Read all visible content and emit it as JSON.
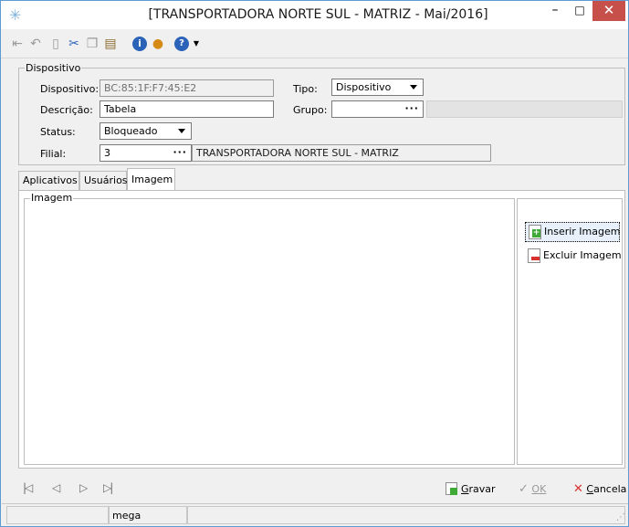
{
  "window": {
    "title": "[TRANSPORTADORA NORTE SUL -  MATRIZ - Mai/2016]",
    "accent": "#5f9bd3",
    "close_color": "#c7504a"
  },
  "toolbar": {
    "icons": [
      "first-icon",
      "back-icon",
      "new-icon",
      "cut-icon",
      "copy-icon",
      "paste-icon",
      "info-icon",
      "user-icon",
      "help-icon"
    ]
  },
  "dispositivo": {
    "legend": "Dispositivo",
    "dispositivo_label": "Dispositivo:",
    "dispositivo_value": "BC:85:1F:F7:45:E2",
    "tipo_label": "Tipo:",
    "tipo_value": "Dispositivo",
    "descricao_label": "Descrição:",
    "descricao_value": "Tabela",
    "grupo_label": "Grupo:",
    "grupo_value": "",
    "status_label": "Status:",
    "status_value": "Bloqueado",
    "filial_label": "Filial:",
    "filial_value": "3",
    "filial_name": "TRANSPORTADORA NORTE SUL - MATRIZ",
    "ellipsis": "···"
  },
  "tabs": [
    {
      "label": "Aplicativos"
    },
    {
      "label": "Usuários"
    },
    {
      "label": "Imagem"
    }
  ],
  "imagem": {
    "legend": "Imagem",
    "insert_label": "Inserir Imagem",
    "delete_label": "Excluir Imagem"
  },
  "navigation": {
    "icons": [
      "first-record-icon",
      "prev-record-icon",
      "next-record-icon",
      "last-record-icon"
    ]
  },
  "actions": {
    "gravar_first": "G",
    "gravar_rest": "ravar",
    "ok_first": "O",
    "ok_rest": "K",
    "cancel_first": "C",
    "cancel_rest": "ancela"
  },
  "status": {
    "user": "mega"
  }
}
